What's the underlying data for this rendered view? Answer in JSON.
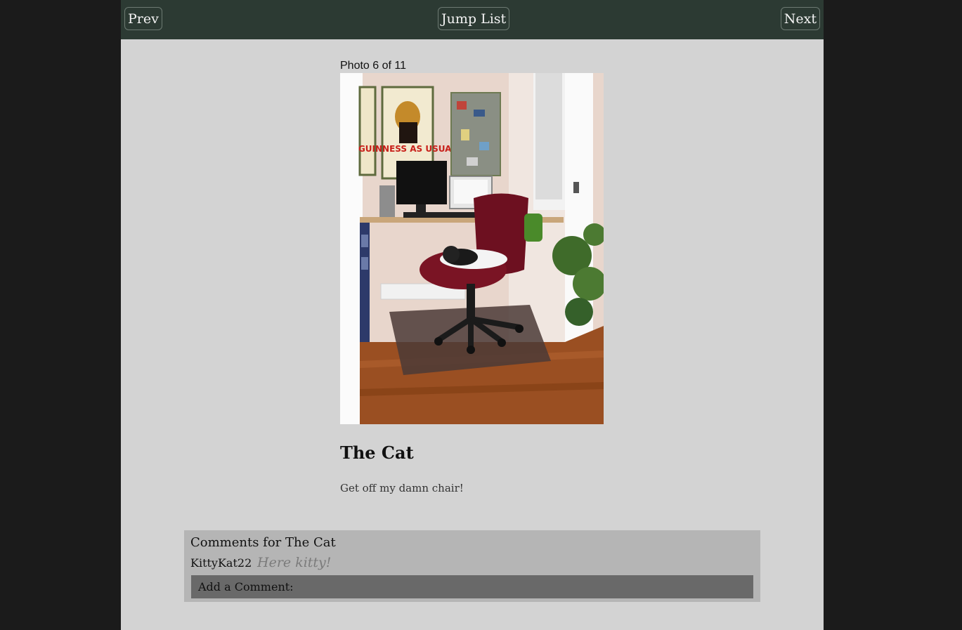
{
  "nav": {
    "prev_label": "Prev",
    "jump_label": "Jump List",
    "next_label": "Next"
  },
  "photo": {
    "counter": "Photo 6 of 11",
    "title": "The Cat",
    "caption": "Get off my damn chair!",
    "poster_text": "GUINNESS AS USUAL"
  },
  "comments": {
    "heading": "Comments for The Cat",
    "items": [
      {
        "author": "KittyKat22",
        "text": "Here kitty!"
      }
    ],
    "add_label": "Add a Comment:"
  },
  "colors": {
    "topbar": "#2c3a33",
    "page_bg": "#d3d3d3",
    "outer_bg": "#1b1b1b",
    "comments_bg": "#b5b5b5",
    "add_comment_bg": "#696969"
  }
}
